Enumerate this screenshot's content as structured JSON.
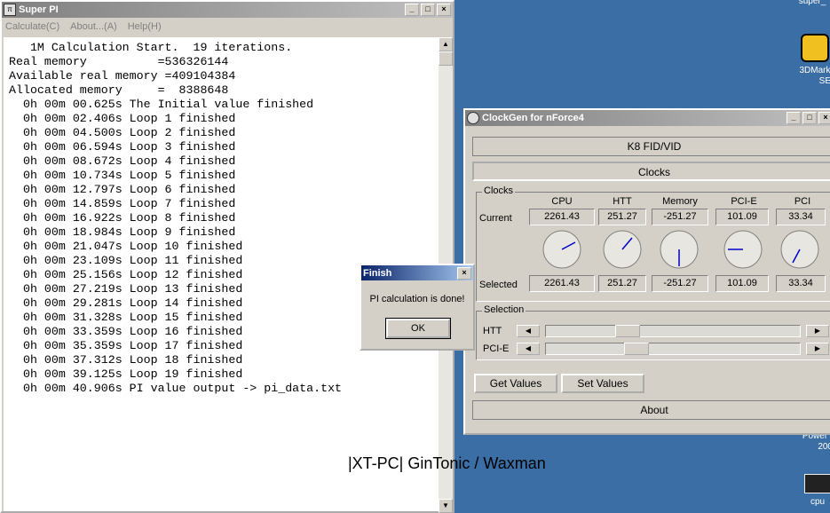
{
  "desktop": {
    "icons": [
      {
        "label": "super_"
      },
      {
        "label": "3DMark",
        "label2": "SE"
      },
      {
        "label": "Power",
        "label2": "200"
      },
      {
        "label": "cpu"
      }
    ]
  },
  "superpi": {
    "title": "Super PI",
    "app_icon": "π",
    "menu": [
      "Calculate(C)",
      "About...(A)",
      "Help(H)"
    ],
    "lines": [
      "   1M Calculation Start.  19 iterations.",
      "Real memory          =536326144",
      "Available real memory =409104384",
      "Allocated memory     =  8388648",
      "  0h 00m 00.625s The Initial value finished",
      "  0h 00m 02.406s Loop 1 finished",
      "  0h 00m 04.500s Loop 2 finished",
      "  0h 00m 06.594s Loop 3 finished",
      "  0h 00m 08.672s Loop 4 finished",
      "  0h 00m 10.734s Loop 5 finished",
      "  0h 00m 12.797s Loop 6 finished",
      "  0h 00m 14.859s Loop 7 finished",
      "  0h 00m 16.922s Loop 8 finished",
      "  0h 00m 18.984s Loop 9 finished",
      "  0h 00m 21.047s Loop 10 finished",
      "  0h 00m 23.109s Loop 11 finished",
      "  0h 00m 25.156s Loop 12 finished",
      "  0h 00m 27.219s Loop 13 finished",
      "  0h 00m 29.281s Loop 14 finished",
      "  0h 00m 31.328s Loop 15 finished",
      "  0h 00m 33.359s Loop 16 finished",
      "  0h 00m 35.359s Loop 17 finished",
      "  0h 00m 37.312s Loop 18 finished",
      "  0h 00m 39.125s Loop 19 finished",
      "  0h 00m 40.906s PI value output -> pi_data.txt"
    ]
  },
  "finish_dialog": {
    "title": "Finish",
    "message": "PI calculation is done!",
    "ok_label": "OK"
  },
  "clockgen": {
    "title": "ClockGen for nForce4",
    "k8_label": "K8 FID/VID",
    "clocks_tab": "Clocks",
    "clocks_group": "Clocks",
    "columns": [
      "CPU",
      "HTT",
      "Memory",
      "PCI-E",
      "PCI"
    ],
    "current_label": "Current",
    "selected_label": "Selected",
    "current": [
      "2261.43",
      "251.27",
      "-251.27",
      "101.09",
      "33.34"
    ],
    "selected": [
      "2261.43",
      "251.27",
      "-251.27",
      "101.09",
      "33.34"
    ],
    "selection_group": "Selection",
    "htt_label": "HTT",
    "pcie_label": "PCI-E",
    "get_values": "Get Values",
    "set_values": "Set Values",
    "about": "About"
  },
  "credit": "|XT-PC| GinTonic / Waxman",
  "colors": {
    "desktop": "#3a6ea5",
    "active_title": "#0a246a",
    "inactive_title": "#808080",
    "needle": "#0000cc"
  }
}
